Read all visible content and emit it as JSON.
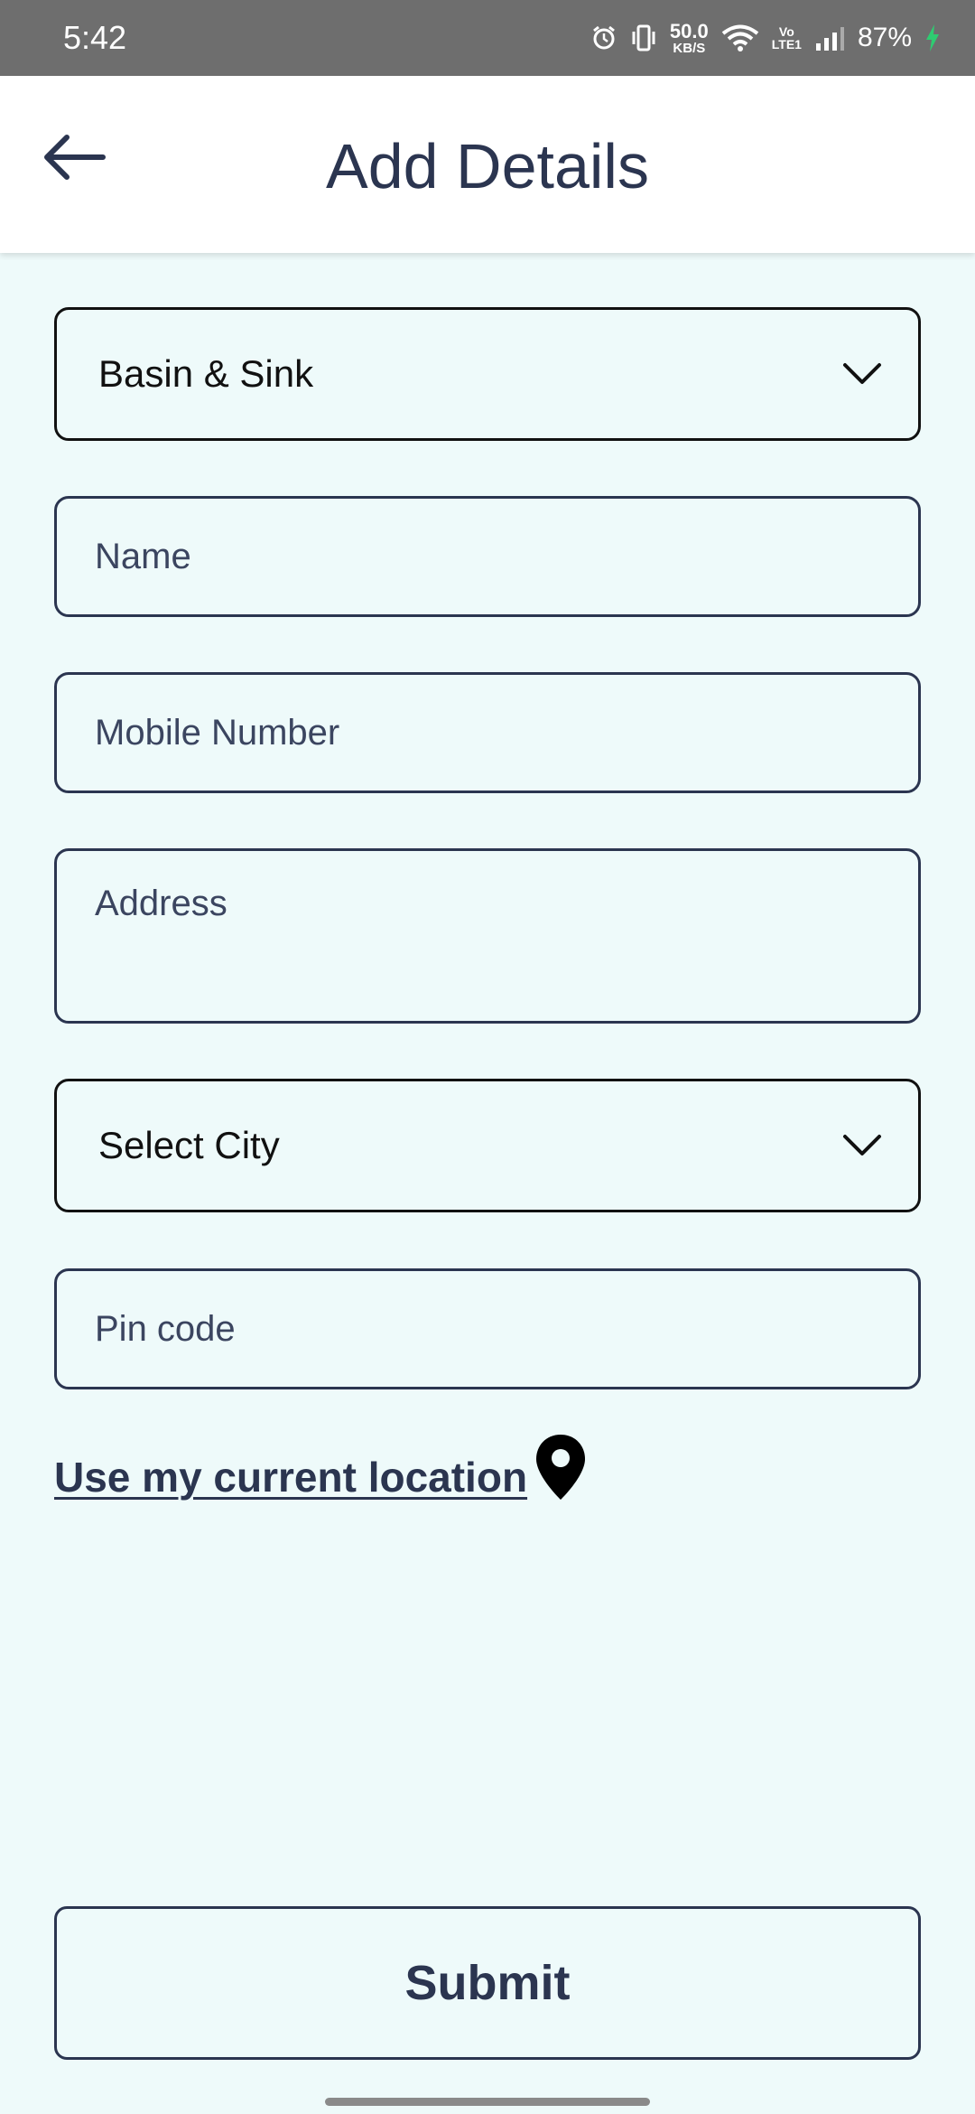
{
  "status_bar": {
    "time": "5:42",
    "net_speed_value": "50.0",
    "net_speed_unit": "KB/S",
    "volte_top": "Vo",
    "volte_bottom": "LTE1",
    "battery": "87%",
    "icons": [
      "alarm-icon",
      "vibrate-icon",
      "wifi-icon",
      "signal-icon",
      "battery-charging-icon"
    ],
    "charging_color": "#2ecc71"
  },
  "app_bar": {
    "title": "Add Details",
    "back_icon": "arrow-left-icon"
  },
  "form": {
    "category_select": {
      "value": "Basin & Sink",
      "icon": "chevron-down-icon"
    },
    "name": {
      "placeholder": "Name",
      "value": ""
    },
    "mobile": {
      "placeholder": "Mobile Number",
      "value": ""
    },
    "address": {
      "placeholder": "Address",
      "value": ""
    },
    "city_select": {
      "value": "Select City",
      "icon": "chevron-down-icon"
    },
    "pincode": {
      "placeholder": "Pin code",
      "value": ""
    },
    "location_link": {
      "label": "Use my current location",
      "icon": "map-pin-icon"
    },
    "submit_label": "Submit"
  },
  "colors": {
    "background": "#eefafa",
    "primary_text": "#2b3550",
    "status_bar": "#6e6e6e"
  }
}
